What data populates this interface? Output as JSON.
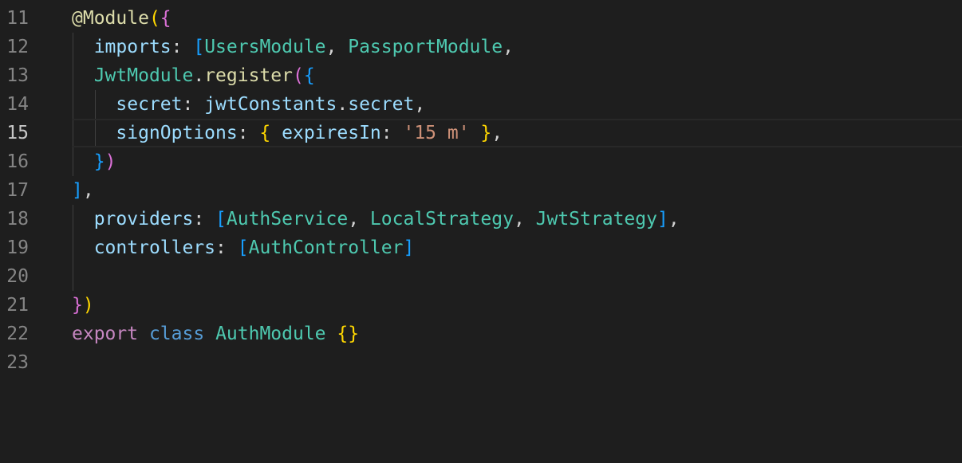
{
  "editor": {
    "theme_colors": {
      "background": "#1e1e1e",
      "line_number": "#858585",
      "keyword": "#569cd6",
      "property": "#9cdcfe",
      "type": "#4ec9b0",
      "string": "#ce9178"
    },
    "current_line": 15,
    "lines": [
      {
        "number": "11",
        "tokens": [
          "@Module",
          "(",
          "{"
        ]
      },
      {
        "number": "12",
        "tokens": [
          "imports",
          ": ",
          "[",
          "UsersModule",
          ", ",
          "PassportModule",
          ","
        ]
      },
      {
        "number": "13",
        "tokens": [
          "JwtModule",
          ".",
          "register",
          "(",
          "{"
        ]
      },
      {
        "number": "14",
        "tokens": [
          "secret",
          ": ",
          "jwtConstants",
          ".",
          "secret",
          ","
        ]
      },
      {
        "number": "15",
        "tokens": [
          "signOptions",
          ": ",
          "{",
          " ",
          "expiresIn",
          ": ",
          "'15 m'",
          " ",
          "}",
          ","
        ]
      },
      {
        "number": "16",
        "tokens": [
          "}",
          ")"
        ]
      },
      {
        "number": "17",
        "tokens": [
          "]",
          ","
        ]
      },
      {
        "number": "18",
        "tokens": [
          "providers",
          ": ",
          "[",
          "AuthService",
          ", ",
          "LocalStrategy",
          ", ",
          "JwtStrategy",
          "]",
          ","
        ]
      },
      {
        "number": "19",
        "tokens": [
          "controllers",
          ": ",
          "[",
          "AuthController",
          "]"
        ]
      },
      {
        "number": "20",
        "tokens": []
      },
      {
        "number": "21",
        "tokens": [
          "}",
          ")"
        ]
      },
      {
        "number": "22",
        "tokens": [
          "export",
          " ",
          "class",
          " ",
          "AuthModule",
          " ",
          "{}"
        ]
      },
      {
        "number": "23",
        "tokens": []
      }
    ]
  }
}
